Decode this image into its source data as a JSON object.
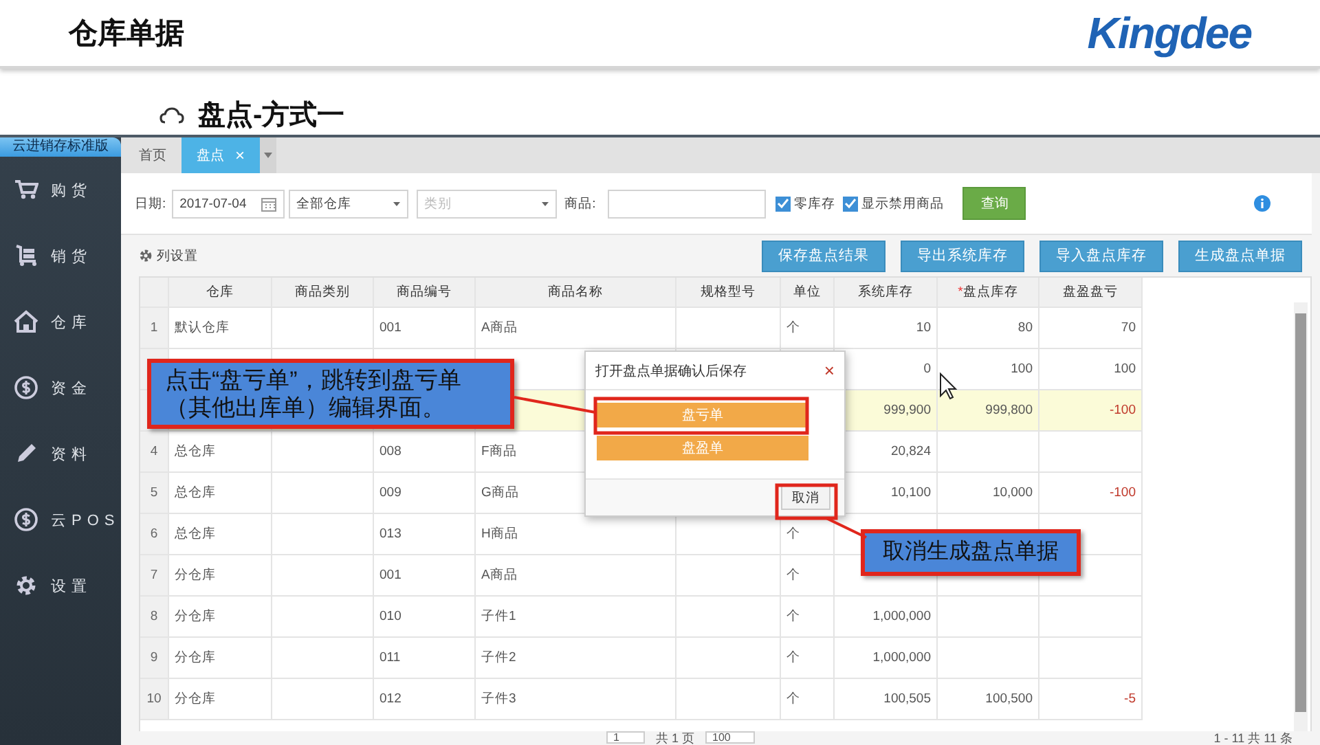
{
  "slide": {
    "title": "仓库单据",
    "logo": "Kingdee",
    "subtitle": "盘点-方式一"
  },
  "sidebar": {
    "edition": "云进销存标准版",
    "items": [
      {
        "label": "购货"
      },
      {
        "label": "销货"
      },
      {
        "label": "仓库"
      },
      {
        "label": "资金"
      },
      {
        "label": "资料"
      },
      {
        "label": "云POS"
      },
      {
        "label": "设置"
      }
    ]
  },
  "tabs": [
    {
      "label": "首页",
      "selected": false
    },
    {
      "label": "盘点",
      "selected": true,
      "close": "×"
    }
  ],
  "filter": {
    "date_label": "日期:",
    "date": "2017-07-04",
    "warehouse": "全部仓库",
    "category_placeholder": "类别",
    "product_label": "商品:",
    "checkboxes": [
      {
        "label": "零库存",
        "checked": true
      },
      {
        "label": "显示禁用商品",
        "checked": true
      }
    ],
    "query_button": "查询"
  },
  "toolbar": {
    "column_settings": "列设置",
    "buttons": [
      "保存盘点结果",
      "导出系统库存",
      "导入盘点库存",
      "生成盘点单据"
    ]
  },
  "table": {
    "columns": [
      {
        "label": "仓库"
      },
      {
        "label": "商品类别"
      },
      {
        "label": "商品编号"
      },
      {
        "label": "商品名称"
      },
      {
        "label": "规格型号"
      },
      {
        "label": "单位"
      },
      {
        "label": "系统库存"
      },
      {
        "label": "盘点库存",
        "required_mark": "*"
      },
      {
        "label": "盘盈盘亏"
      }
    ],
    "rows": [
      {
        "number": "1",
        "selected": false,
        "cells": [
          "默认仓库",
          null,
          "001",
          "A商品",
          null,
          "个",
          "10",
          "80",
          "70"
        ],
        "diff_negative": false
      },
      {
        "number": null,
        "selected": false,
        "cells": [
          null,
          null,
          null,
          null,
          null,
          null,
          "0",
          "100",
          "100"
        ],
        "diff_negative": false
      },
      {
        "number": null,
        "selected": true,
        "cells": [
          null,
          null,
          null,
          null,
          null,
          null,
          "999,900",
          "999,800",
          "-100"
        ],
        "diff_negative": true
      },
      {
        "number": "4",
        "selected": false,
        "cells": [
          "总仓库",
          null,
          "008",
          "F商品",
          null,
          null,
          "20,824",
          null,
          null
        ]
      },
      {
        "number": "5",
        "selected": false,
        "cells": [
          "总仓库",
          null,
          "009",
          "G商品",
          null,
          null,
          "10,100",
          "10,000",
          "-100"
        ],
        "diff_negative": true
      },
      {
        "number": "6",
        "selected": false,
        "cells": [
          "总仓库",
          null,
          "013",
          "H商品",
          null,
          "个",
          null,
          null,
          null
        ]
      },
      {
        "number": "7",
        "selected": false,
        "cells": [
          "分仓库",
          null,
          "001",
          "A商品",
          null,
          "个",
          null,
          null,
          null
        ]
      },
      {
        "number": "8",
        "selected": false,
        "cells": [
          "分仓库",
          null,
          "010",
          "子件1",
          null,
          "个",
          "1,000,000",
          null,
          null
        ]
      },
      {
        "number": "9",
        "selected": false,
        "cells": [
          "分仓库",
          null,
          "011",
          "子件2",
          null,
          "个",
          "1,000,000",
          null,
          null
        ]
      },
      {
        "number": "10",
        "selected": false,
        "cells": [
          "分仓库",
          null,
          "012",
          "子件3",
          null,
          "个",
          "100,505",
          "100,500",
          "-5"
        ],
        "diff_negative": true
      }
    ]
  },
  "pagination": {
    "page": "1",
    "pages": "共 1 页",
    "page_size": "100",
    "summary": "1 - 11 共 11 条"
  },
  "dialog": {
    "title": "打开盘点单据确认后保存",
    "close": "×",
    "options": [
      "盘亏单",
      "盘盈单"
    ],
    "cancel": "取消"
  },
  "callouts": [
    {
      "text": "点击“盘亏单”，跳转到盘亏单（其他出库单）编辑界面。"
    },
    {
      "text": "取消生成盘点单据"
    }
  ]
}
